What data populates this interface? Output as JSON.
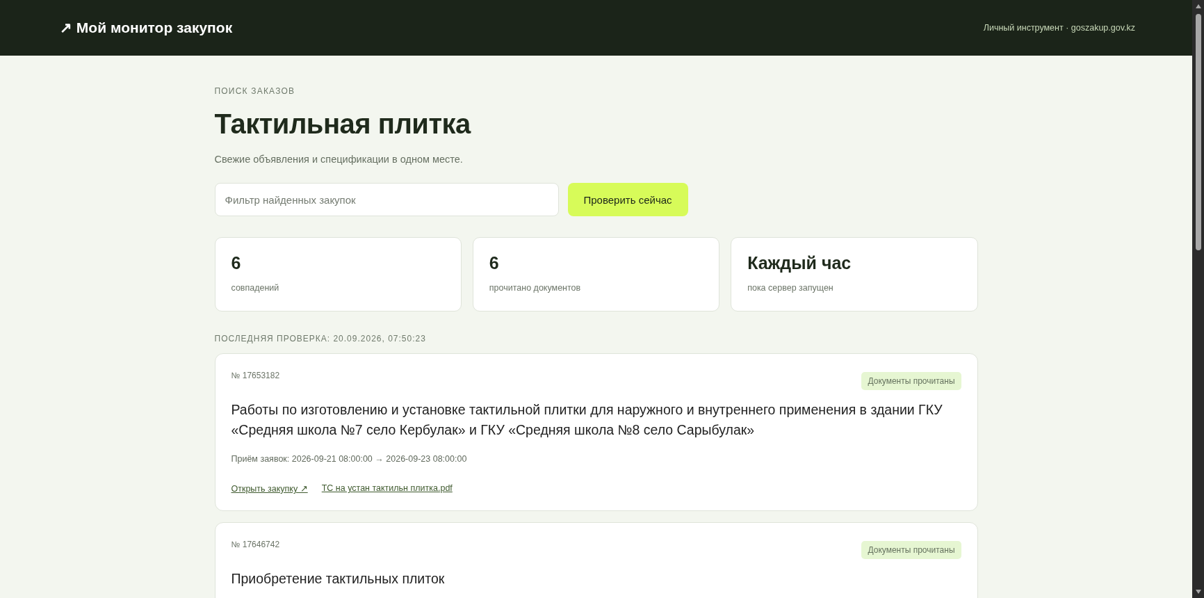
{
  "header": {
    "logo_arrow": "↗",
    "title": "Мой монитор закупок",
    "note": "Личный инструмент · goszakup.gov.kz"
  },
  "hero": {
    "eyebrow": "ПОИСК ЗАКАЗОВ",
    "title": "Тактильная плитка",
    "subtitle": "Свежие объявления и спецификации в одном месте."
  },
  "filter": {
    "placeholder": "Фильтр найденных закупок"
  },
  "check_button": "Проверить сейчас",
  "stats": [
    {
      "value": "6",
      "label": "совпадений"
    },
    {
      "value": "6",
      "label": "прочитано документов"
    },
    {
      "value": "Каждый час",
      "label": "пока сервер запущен"
    }
  ],
  "last_check": "ПОСЛЕДНЯЯ ПРОВЕРКА: 20.09.2026, 07:50:23",
  "results": [
    {
      "number": "№ 17653182",
      "badge": "Документы прочитаны",
      "title": "Работы по изготовлению и установке тактильной плитки для наружного и внутреннего применения в здании ГКУ «Средняя школа №7 село Кербулак» и ГКУ «Средняя школа №8 село Сарыбулак»",
      "period": "Приём заявок: 2026-09-21 08:00:00 → 2026-09-23 08:00:00",
      "links": [
        "Открыть закупку ↗",
        "ТС на устан тактильн плитка.pdf"
      ]
    },
    {
      "number": "№ 17646742",
      "badge": "Документы прочитаны",
      "title": "Приобретение тактильных плиток"
    }
  ]
}
